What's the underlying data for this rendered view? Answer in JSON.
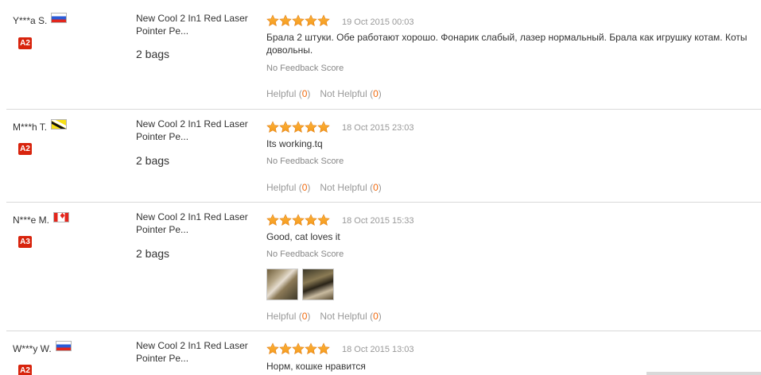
{
  "colors": {
    "star": "#f59a1c",
    "badge": "#d8240d",
    "count": "#f06a0f",
    "border": "#d9d9d9"
  },
  "reviews": [
    {
      "user": "Y***a S.",
      "flag": "ru-flag-icon",
      "badge": "A2",
      "product": "New Cool 2 In1 Red Laser Pointer Pe...",
      "qty": "2 bags",
      "rating": 5,
      "date": "19 Oct 2015 00:03",
      "text": "Брала 2 штуки. Обе работают хорошо. Фонарик слабый, лазер нормальный. Брала как игрушку котам. Коты довольны.",
      "feedback": "No Feedback Score",
      "helpful_label": "Helpful",
      "helpful_count": "0",
      "not_helpful_label": "Not Helpful",
      "not_helpful_count": "0"
    },
    {
      "user": "M***h T.",
      "flag": "bn-flag-icon",
      "badge": "A2",
      "product": "New Cool 2 In1 Red Laser Pointer Pe...",
      "qty": "2 bags",
      "rating": 5,
      "date": "18 Oct 2015 23:03",
      "text": "Its working.tq",
      "feedback": "No Feedback Score",
      "helpful_label": "Helpful",
      "helpful_count": "0",
      "not_helpful_label": "Not Helpful",
      "not_helpful_count": "0"
    },
    {
      "user": "N***e M.",
      "flag": "ca-flag-icon",
      "badge": "A3",
      "product": "New Cool 2 In1 Red Laser Pointer Pe...",
      "qty": "2 bags",
      "rating": 5,
      "date": "18 Oct 2015 15:33",
      "text": "Good, cat loves it",
      "feedback": "No Feedback Score",
      "helpful_label": "Helpful",
      "helpful_count": "0",
      "not_helpful_label": "Not Helpful",
      "not_helpful_count": "0"
    },
    {
      "user": "W***y W.",
      "flag": "ru-flag-icon",
      "badge": "A2",
      "product": "New Cool 2 In1 Red Laser Pointer Pe...",
      "rating": 5,
      "date": "18 Oct 2015 13:03",
      "text": "Норм, кошке нравится"
    }
  ]
}
